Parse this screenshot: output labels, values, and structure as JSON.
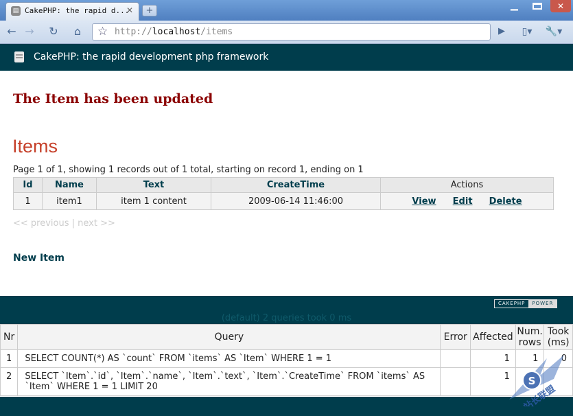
{
  "browser": {
    "tab_title": "CakePHP: the rapid d...",
    "url_scheme": "http://",
    "url_host": "localhost",
    "url_path": "/items"
  },
  "header": {
    "title": "CakePHP: the rapid development php framework"
  },
  "flash_message": "The Item has been updated",
  "page_title": "Items",
  "counter_text": "Page 1 of 1, showing 1 records out of 1 total, starting on record 1, ending on 1",
  "items_table": {
    "headers": {
      "id": "Id",
      "name": "Name",
      "text": "Text",
      "create_time": "CreateTime",
      "actions": "Actions"
    },
    "rows": [
      {
        "id": "1",
        "name": "item1",
        "text": "item 1 content",
        "create_time": "2009-06-14 11:46:00",
        "view": "View",
        "edit": "Edit",
        "delete": "Delete"
      }
    ]
  },
  "paging": {
    "previous": "<< previous",
    "separator": "|",
    "next": "next >>"
  },
  "new_item_link": "New Item",
  "footer": {
    "power_left": "CAKEPHP",
    "power_right": "POWER"
  },
  "sql_log": {
    "caption": "(default) 2 queries took 0 ms",
    "headers": {
      "nr": "Nr",
      "query": "Query",
      "error": "Error",
      "affected": "Affected",
      "num_rows": "Num. rows",
      "took": "Took (ms)"
    },
    "rows": [
      {
        "nr": "1",
        "query": "SELECT COUNT(*) AS `count` FROM `items` AS `Item` WHERE 1 = 1",
        "error": "",
        "affected": "1",
        "num_rows": "1",
        "took": "0"
      },
      {
        "nr": "2",
        "query": "SELECT `Item`.`id`, `Item`.`name`, `Item`.`text`, `Item`.`CreateTime` FROM `items` AS `Item` WHERE 1 = 1 LIMIT 20",
        "error": "",
        "affected": "1",
        "num_rows": "",
        "took": ""
      }
    ]
  },
  "watermark": {
    "text": "站长联盟"
  },
  "colors": {
    "cake_dark": "#003d4c",
    "flash": "#8b0000",
    "heading": "#c6412b"
  }
}
